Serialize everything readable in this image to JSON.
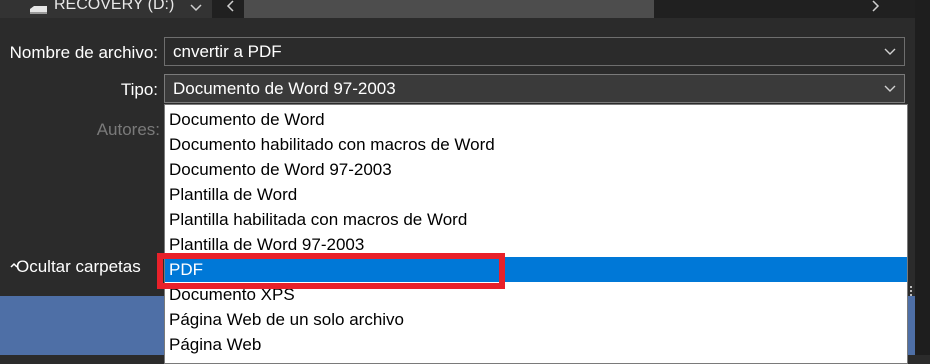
{
  "toolbar": {
    "drive_label": "RECOVERY (D:)"
  },
  "form": {
    "filename_label": "Nombre de archivo:",
    "filename_value": "cnvertir a PDF",
    "type_label": "Tipo:",
    "type_value": "Documento de Word 97-2003",
    "authors_label": "Autores:"
  },
  "dropdown": {
    "options": [
      "Documento de Word",
      "Documento habilitado con macros de Word",
      "Documento de Word 97-2003",
      "Plantilla de Word",
      "Plantilla habilitada con macros de Word",
      "Plantilla de Word 97-2003",
      "PDF",
      "Documento XPS",
      "Página Web de un solo archivo",
      "Página Web"
    ],
    "selected": "PDF"
  },
  "sidebar": {
    "hide_folders_label": "Ocultar carpetas"
  },
  "colors": {
    "selection": "#0078d7",
    "highlight_border": "#e8212a",
    "dialog_background": "#2b2b2b"
  }
}
